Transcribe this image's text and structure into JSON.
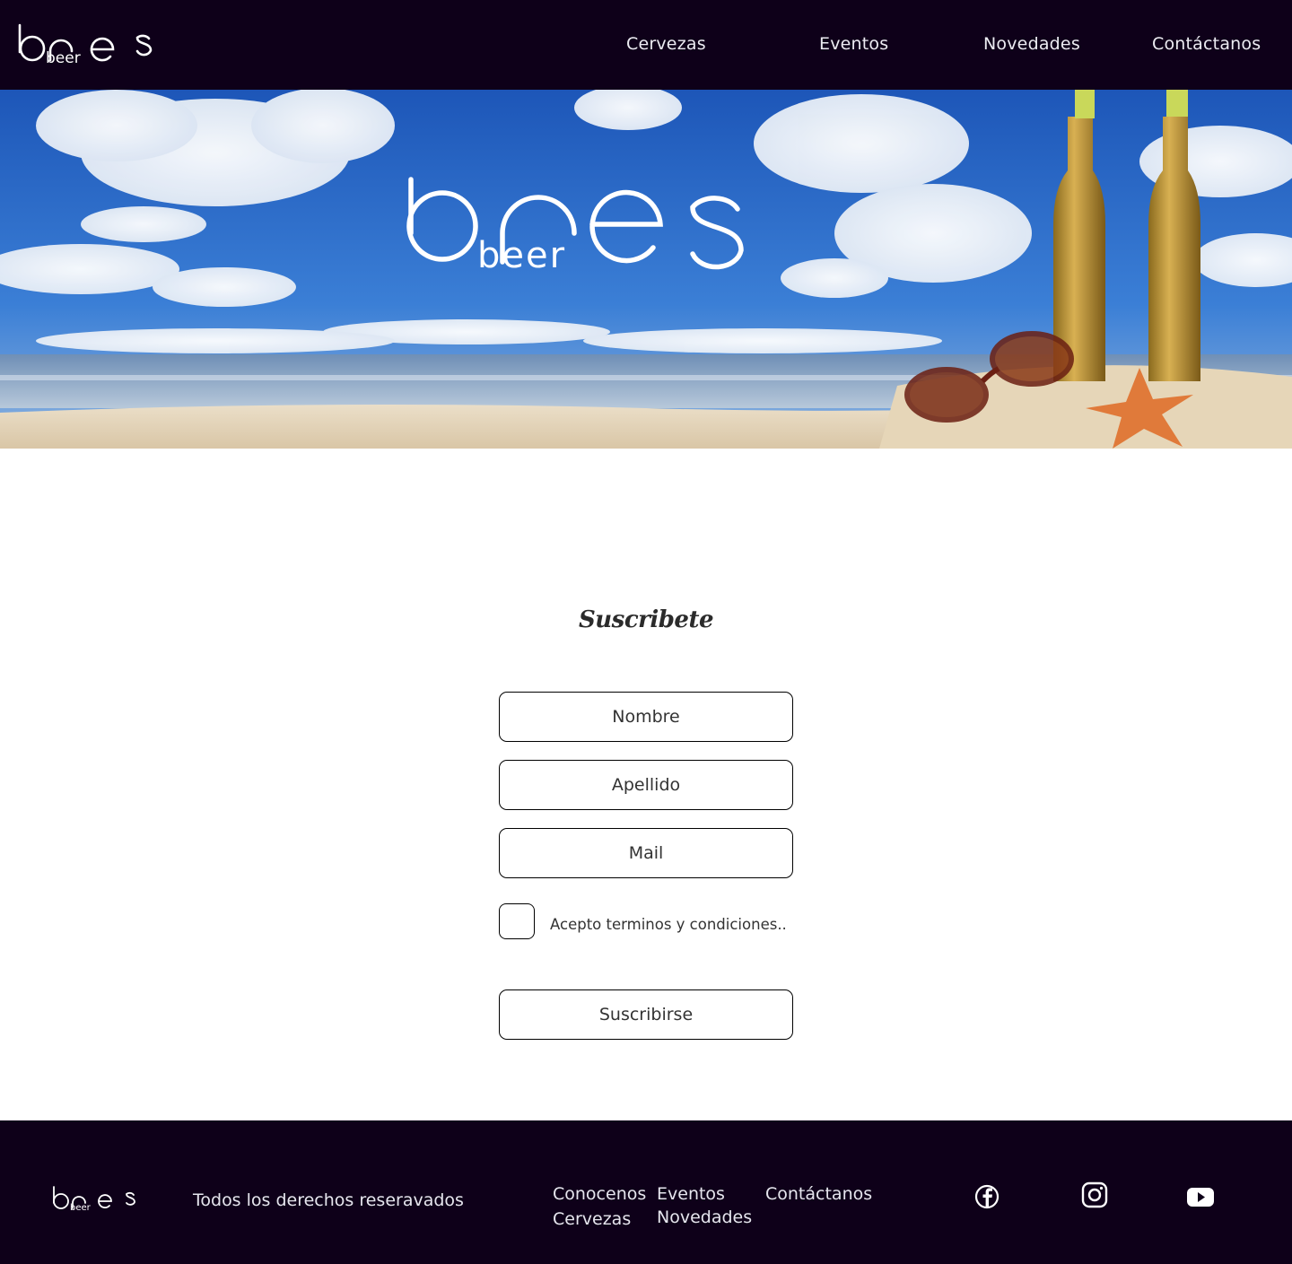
{
  "brand": {
    "logo_main": "bres",
    "logo_sub": "beer"
  },
  "nav": {
    "items": [
      {
        "label": "Cervezas"
      },
      {
        "label": "Eventos"
      },
      {
        "label": "Novedades"
      },
      {
        "label": "Contáctanos"
      }
    ]
  },
  "subscribe": {
    "title": "Suscribete",
    "first_name_placeholder": "Nombre",
    "last_name_placeholder": "Apellido",
    "email_placeholder": "Mail",
    "terms_label": "Acepto terminos y condiciones..",
    "submit_label": "Suscribirse"
  },
  "footer": {
    "copyright": "Todos los derechos reseravados",
    "links": {
      "about": "Conocenos",
      "beers": "Cervezas",
      "events": "Eventos",
      "news": "Novedades",
      "contact": "Contáctanos"
    },
    "social_icons": [
      "facebook-icon",
      "instagram-icon",
      "youtube-icon"
    ]
  },
  "colors": {
    "header_bg": "#0e0019",
    "footer_bg": "#0e0019",
    "sky": "#2f6fd0",
    "sand": "#e8d9c0",
    "text_light": "#ececf2"
  }
}
